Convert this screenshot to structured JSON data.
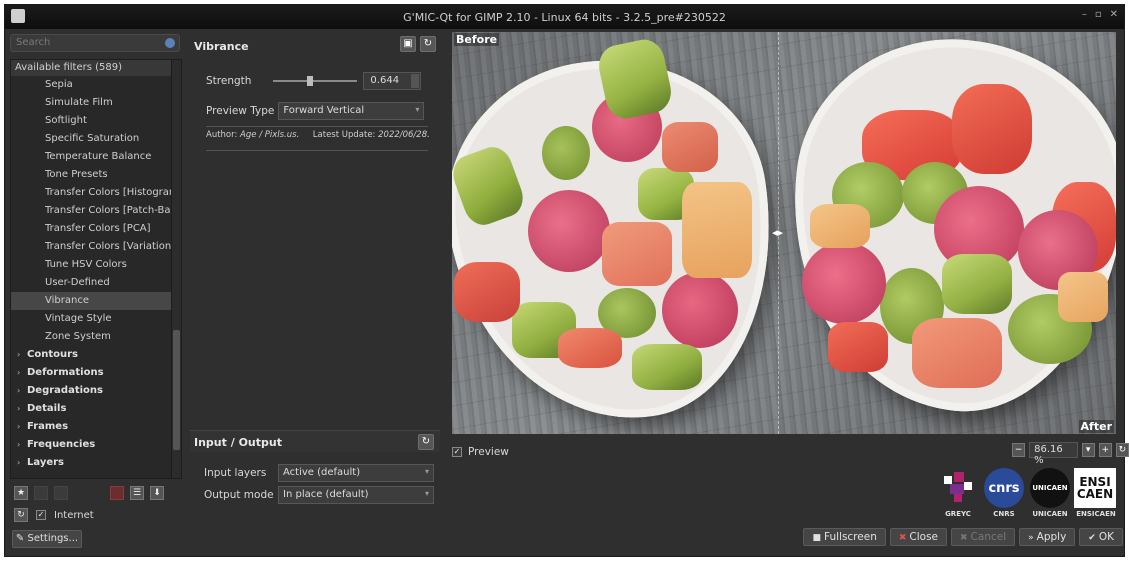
{
  "window": {
    "title": "G'MIC-Qt for GIMP 2.10 - Linux 64 bits - 3.2.5_pre#230522",
    "controls": [
      "–",
      "▫",
      "✕"
    ]
  },
  "left": {
    "search_placeholder": "Search",
    "filters_header": "Available filters (589)",
    "items": [
      "Sepia",
      "Simulate Film",
      "Softlight",
      "Specific Saturation",
      "Temperature Balance",
      "Tone Presets",
      "Transfer Colors [Histogram",
      "Transfer Colors [Patch-Bas",
      "Transfer Colors [PCA]",
      "Transfer Colors [Variationa",
      "Tune HSV Colors",
      "User-Defined",
      "Vibrance",
      "Vintage Style",
      "Zone System"
    ],
    "selected_item": "Vibrance",
    "folders": [
      "Contours",
      "Deformations",
      "Degradations",
      "Details",
      "Frames",
      "Frequencies",
      "Layers"
    ],
    "internet_label": "Internet",
    "settings_label": "Settings..."
  },
  "filter": {
    "title": "Vibrance",
    "strength_label": "Strength",
    "strength_value": "0.644",
    "strength_fraction": 0.4,
    "preview_type_label": "Preview Type",
    "preview_type_value": "Forward Vertical",
    "author_label": "Author:",
    "author_value": "Age / Pixls.us.",
    "update_label": "Latest Update:",
    "update_value": "2022/06/28."
  },
  "io": {
    "title": "Input / Output",
    "input_label": "Input layers",
    "input_value": "Active (default)",
    "output_label": "Output mode",
    "output_value": "In place (default)"
  },
  "preview": {
    "before_tag": "Before",
    "after_tag": "After",
    "preview_label": "Preview",
    "zoom": "86.16 %"
  },
  "logos": [
    {
      "text": "",
      "caption": "GREYC"
    },
    {
      "text": "cnrs",
      "caption": "CNRS"
    },
    {
      "text": "UNICAEN",
      "caption": "UNICAEN"
    },
    {
      "text": "ENSI CAEN",
      "caption": "ENSICAEN"
    }
  ],
  "buttons": {
    "fullscreen": "Fullscreen",
    "close": "Close",
    "cancel": "Cancel",
    "apply": "Apply",
    "ok": "OK"
  }
}
